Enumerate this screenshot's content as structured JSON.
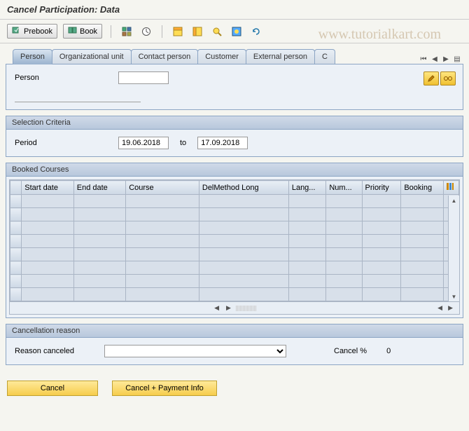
{
  "title": "Cancel Participation: Data",
  "watermark": "www.tutorialkart.com",
  "toolbar": {
    "prebook": "Prebook",
    "book": "Book"
  },
  "tabs": [
    "Person",
    "Organizational unit",
    "Contact person",
    "Customer",
    "External person",
    "C"
  ],
  "person_section": {
    "label": "Person",
    "value": ""
  },
  "selection_criteria": {
    "title": "Selection Criteria",
    "period_label": "Period",
    "from": "19.06.2018",
    "to_label": "to",
    "to": "17.09.2018"
  },
  "booked_courses": {
    "title": "Booked Courses",
    "columns": [
      "Start date",
      "End date",
      "Course",
      "DelMethod Long",
      "Lang...",
      "Num...",
      "Priority",
      "Booking"
    ]
  },
  "cancellation": {
    "title": "Cancellation reason",
    "reason_label": "Reason canceled",
    "reason_value": "",
    "pct_label": "Cancel %",
    "pct_value": "0"
  },
  "actions": {
    "cancel": "Cancel",
    "cancel_payment": "Cancel + Payment Info"
  }
}
